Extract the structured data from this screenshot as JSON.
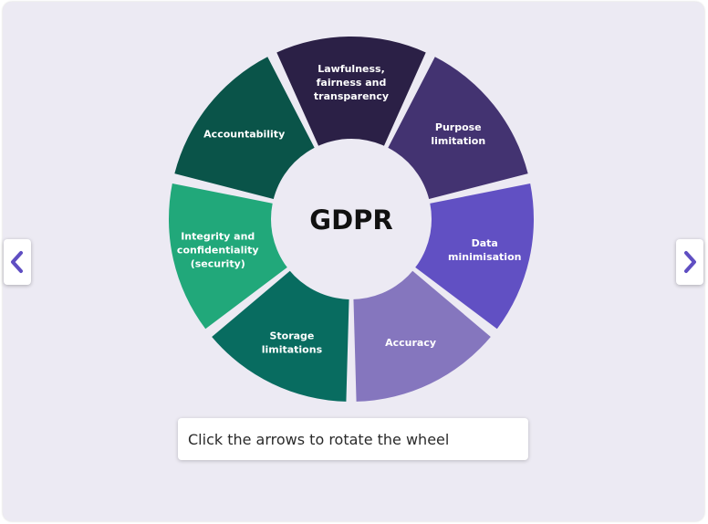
{
  "center_label": "GDPR",
  "caption": "Click the arrows to rotate the wheel",
  "prev_arrow": "chevron-left-icon",
  "next_arrow": "chevron-right-icon",
  "colors": {
    "background": "#eceaf3",
    "arrow": "#5f4ec2"
  },
  "segments": [
    {
      "lines": [
        "Lawfulness,",
        "fairness and",
        "transparency"
      ],
      "color": "#2b2046"
    },
    {
      "lines": [
        "Purpose",
        "limitation"
      ],
      "color": "#433371"
    },
    {
      "lines": [
        "Data",
        "minimisation"
      ],
      "color": "#6150c3"
    },
    {
      "lines": [
        "Accuracy"
      ],
      "color": "#8576be"
    },
    {
      "lines": [
        "Storage",
        "limitations"
      ],
      "color": "#086c60"
    },
    {
      "lines": [
        "Integrity and",
        "confidentiality",
        "(security)"
      ],
      "color": "#21a87a"
    },
    {
      "lines": [
        "Accountability"
      ],
      "color": "#0a5449"
    }
  ]
}
